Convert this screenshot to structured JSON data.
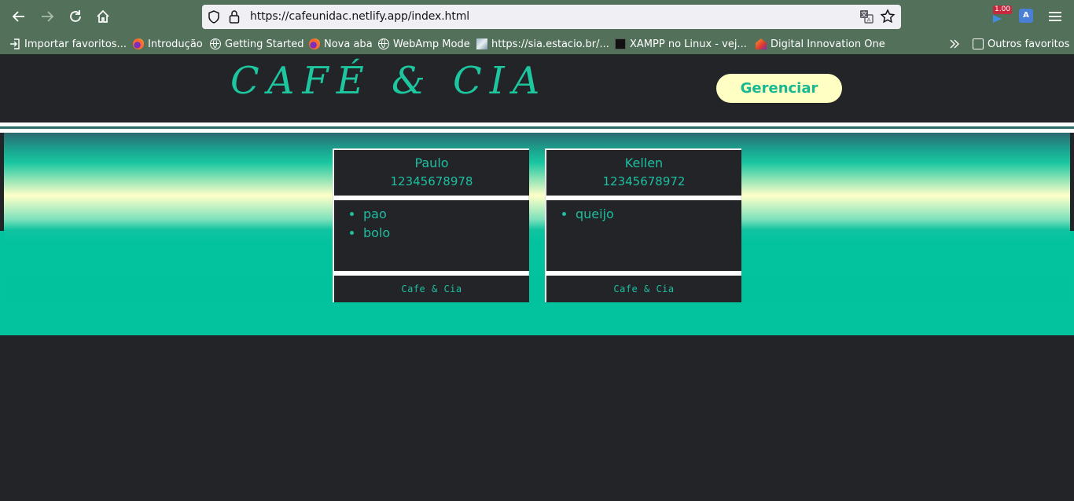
{
  "browser": {
    "url": "https://cafeunidac.netlify.app/index.html",
    "extension_badge": "1.00",
    "bookmarks": [
      {
        "label": "Importar favoritos...",
        "icon": "import-icon"
      },
      {
        "label": "Introdução",
        "icon": "firefox-icon"
      },
      {
        "label": "Getting Started",
        "icon": "globe-icon"
      },
      {
        "label": "Nova aba",
        "icon": "firefox-icon"
      },
      {
        "label": "WebAmp Mode",
        "icon": "globe-icon"
      },
      {
        "label": "https://sia.estacio.br/...",
        "icon": "sia-icon"
      },
      {
        "label": "XAMPP no Linux - vej...",
        "icon": "xampp-icon"
      },
      {
        "label": "Digital Innovation One",
        "icon": "dio-icon"
      }
    ],
    "other_bookmarks": "Outros favoritos"
  },
  "header": {
    "logo": "CAFÉ & CIA",
    "manage_label": "Gerenciar"
  },
  "cards": [
    {
      "name": "Paulo",
      "phone": "12345678978",
      "items": [
        "pao",
        "bolo"
      ],
      "footer": "Cafe & Cia"
    },
    {
      "name": "Kellen",
      "phone": "12345678972",
      "items": [
        "queijo"
      ],
      "footer": "Cafe & Cia"
    }
  ],
  "colors": {
    "chrome": "#53705a",
    "page_bg": "#232428",
    "accent": "#1dbfa0",
    "button_bg": "#ffffc4"
  }
}
